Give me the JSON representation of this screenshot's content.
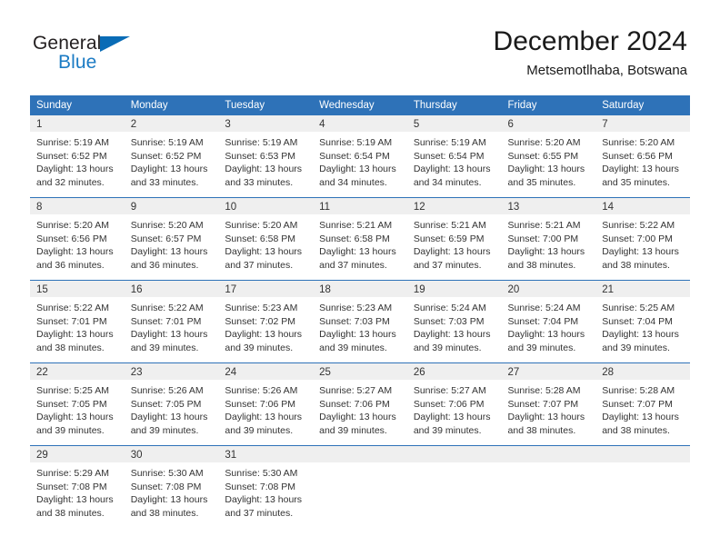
{
  "brand": {
    "name_part1": "General",
    "name_part2": "Blue",
    "triangle_color": "#0a6cb6",
    "blue_color": "#1b7bc4"
  },
  "header": {
    "title": "December 2024",
    "subtitle": "Metsemotlhaba, Botswana"
  },
  "theme": {
    "header_blue": "#2e72b8",
    "daynum_gray": "#efefef",
    "text": "#333333"
  },
  "weekday_headers": [
    "Sunday",
    "Monday",
    "Tuesday",
    "Wednesday",
    "Thursday",
    "Friday",
    "Saturday"
  ],
  "weeks": [
    {
      "days": [
        {
          "num": "1",
          "sunrise": "Sunrise: 5:19 AM",
          "sunset": "Sunset: 6:52 PM",
          "daylight1": "Daylight: 13 hours",
          "daylight2": "and 32 minutes."
        },
        {
          "num": "2",
          "sunrise": "Sunrise: 5:19 AM",
          "sunset": "Sunset: 6:52 PM",
          "daylight1": "Daylight: 13 hours",
          "daylight2": "and 33 minutes."
        },
        {
          "num": "3",
          "sunrise": "Sunrise: 5:19 AM",
          "sunset": "Sunset: 6:53 PM",
          "daylight1": "Daylight: 13 hours",
          "daylight2": "and 33 minutes."
        },
        {
          "num": "4",
          "sunrise": "Sunrise: 5:19 AM",
          "sunset": "Sunset: 6:54 PM",
          "daylight1": "Daylight: 13 hours",
          "daylight2": "and 34 minutes."
        },
        {
          "num": "5",
          "sunrise": "Sunrise: 5:19 AM",
          "sunset": "Sunset: 6:54 PM",
          "daylight1": "Daylight: 13 hours",
          "daylight2": "and 34 minutes."
        },
        {
          "num": "6",
          "sunrise": "Sunrise: 5:20 AM",
          "sunset": "Sunset: 6:55 PM",
          "daylight1": "Daylight: 13 hours",
          "daylight2": "and 35 minutes."
        },
        {
          "num": "7",
          "sunrise": "Sunrise: 5:20 AM",
          "sunset": "Sunset: 6:56 PM",
          "daylight1": "Daylight: 13 hours",
          "daylight2": "and 35 minutes."
        }
      ]
    },
    {
      "days": [
        {
          "num": "8",
          "sunrise": "Sunrise: 5:20 AM",
          "sunset": "Sunset: 6:56 PM",
          "daylight1": "Daylight: 13 hours",
          "daylight2": "and 36 minutes."
        },
        {
          "num": "9",
          "sunrise": "Sunrise: 5:20 AM",
          "sunset": "Sunset: 6:57 PM",
          "daylight1": "Daylight: 13 hours",
          "daylight2": "and 36 minutes."
        },
        {
          "num": "10",
          "sunrise": "Sunrise: 5:20 AM",
          "sunset": "Sunset: 6:58 PM",
          "daylight1": "Daylight: 13 hours",
          "daylight2": "and 37 minutes."
        },
        {
          "num": "11",
          "sunrise": "Sunrise: 5:21 AM",
          "sunset": "Sunset: 6:58 PM",
          "daylight1": "Daylight: 13 hours",
          "daylight2": "and 37 minutes."
        },
        {
          "num": "12",
          "sunrise": "Sunrise: 5:21 AM",
          "sunset": "Sunset: 6:59 PM",
          "daylight1": "Daylight: 13 hours",
          "daylight2": "and 37 minutes."
        },
        {
          "num": "13",
          "sunrise": "Sunrise: 5:21 AM",
          "sunset": "Sunset: 7:00 PM",
          "daylight1": "Daylight: 13 hours",
          "daylight2": "and 38 minutes."
        },
        {
          "num": "14",
          "sunrise": "Sunrise: 5:22 AM",
          "sunset": "Sunset: 7:00 PM",
          "daylight1": "Daylight: 13 hours",
          "daylight2": "and 38 minutes."
        }
      ]
    },
    {
      "days": [
        {
          "num": "15",
          "sunrise": "Sunrise: 5:22 AM",
          "sunset": "Sunset: 7:01 PM",
          "daylight1": "Daylight: 13 hours",
          "daylight2": "and 38 minutes."
        },
        {
          "num": "16",
          "sunrise": "Sunrise: 5:22 AM",
          "sunset": "Sunset: 7:01 PM",
          "daylight1": "Daylight: 13 hours",
          "daylight2": "and 39 minutes."
        },
        {
          "num": "17",
          "sunrise": "Sunrise: 5:23 AM",
          "sunset": "Sunset: 7:02 PM",
          "daylight1": "Daylight: 13 hours",
          "daylight2": "and 39 minutes."
        },
        {
          "num": "18",
          "sunrise": "Sunrise: 5:23 AM",
          "sunset": "Sunset: 7:03 PM",
          "daylight1": "Daylight: 13 hours",
          "daylight2": "and 39 minutes."
        },
        {
          "num": "19",
          "sunrise": "Sunrise: 5:24 AM",
          "sunset": "Sunset: 7:03 PM",
          "daylight1": "Daylight: 13 hours",
          "daylight2": "and 39 minutes."
        },
        {
          "num": "20",
          "sunrise": "Sunrise: 5:24 AM",
          "sunset": "Sunset: 7:04 PM",
          "daylight1": "Daylight: 13 hours",
          "daylight2": "and 39 minutes."
        },
        {
          "num": "21",
          "sunrise": "Sunrise: 5:25 AM",
          "sunset": "Sunset: 7:04 PM",
          "daylight1": "Daylight: 13 hours",
          "daylight2": "and 39 minutes."
        }
      ]
    },
    {
      "days": [
        {
          "num": "22",
          "sunrise": "Sunrise: 5:25 AM",
          "sunset": "Sunset: 7:05 PM",
          "daylight1": "Daylight: 13 hours",
          "daylight2": "and 39 minutes."
        },
        {
          "num": "23",
          "sunrise": "Sunrise: 5:26 AM",
          "sunset": "Sunset: 7:05 PM",
          "daylight1": "Daylight: 13 hours",
          "daylight2": "and 39 minutes."
        },
        {
          "num": "24",
          "sunrise": "Sunrise: 5:26 AM",
          "sunset": "Sunset: 7:06 PM",
          "daylight1": "Daylight: 13 hours",
          "daylight2": "and 39 minutes."
        },
        {
          "num": "25",
          "sunrise": "Sunrise: 5:27 AM",
          "sunset": "Sunset: 7:06 PM",
          "daylight1": "Daylight: 13 hours",
          "daylight2": "and 39 minutes."
        },
        {
          "num": "26",
          "sunrise": "Sunrise: 5:27 AM",
          "sunset": "Sunset: 7:06 PM",
          "daylight1": "Daylight: 13 hours",
          "daylight2": "and 39 minutes."
        },
        {
          "num": "27",
          "sunrise": "Sunrise: 5:28 AM",
          "sunset": "Sunset: 7:07 PM",
          "daylight1": "Daylight: 13 hours",
          "daylight2": "and 38 minutes."
        },
        {
          "num": "28",
          "sunrise": "Sunrise: 5:28 AM",
          "sunset": "Sunset: 7:07 PM",
          "daylight1": "Daylight: 13 hours",
          "daylight2": "and 38 minutes."
        }
      ]
    },
    {
      "days": [
        {
          "num": "29",
          "sunrise": "Sunrise: 5:29 AM",
          "sunset": "Sunset: 7:08 PM",
          "daylight1": "Daylight: 13 hours",
          "daylight2": "and 38 minutes."
        },
        {
          "num": "30",
          "sunrise": "Sunrise: 5:30 AM",
          "sunset": "Sunset: 7:08 PM",
          "daylight1": "Daylight: 13 hours",
          "daylight2": "and 38 minutes."
        },
        {
          "num": "31",
          "sunrise": "Sunrise: 5:30 AM",
          "sunset": "Sunset: 7:08 PM",
          "daylight1": "Daylight: 13 hours",
          "daylight2": "and 37 minutes."
        },
        {
          "num": "",
          "sunrise": "",
          "sunset": "",
          "daylight1": "",
          "daylight2": ""
        },
        {
          "num": "",
          "sunrise": "",
          "sunset": "",
          "daylight1": "",
          "daylight2": ""
        },
        {
          "num": "",
          "sunrise": "",
          "sunset": "",
          "daylight1": "",
          "daylight2": ""
        },
        {
          "num": "",
          "sunrise": "",
          "sunset": "",
          "daylight1": "",
          "daylight2": ""
        }
      ]
    }
  ]
}
